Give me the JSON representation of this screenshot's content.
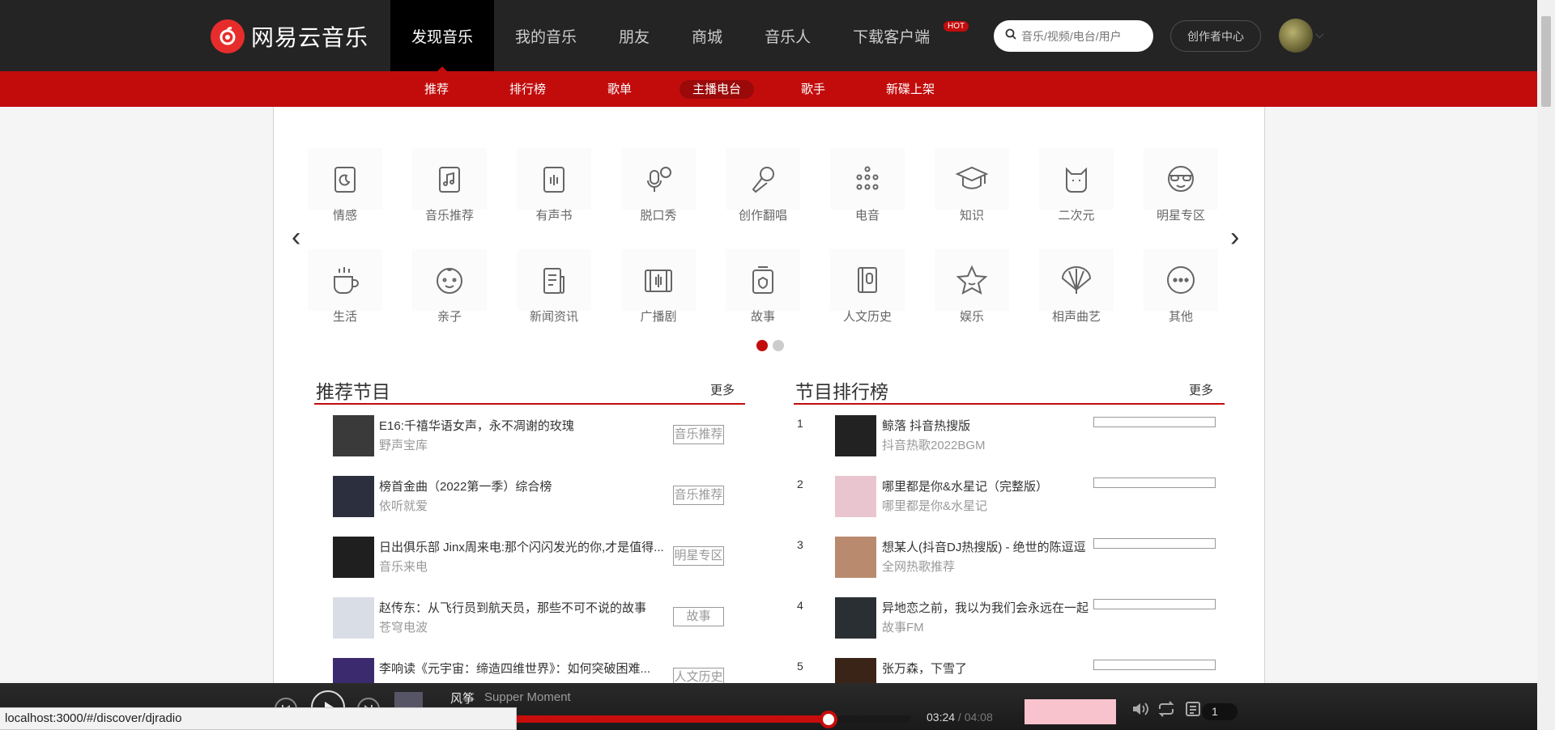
{
  "app": {
    "logo_text": "网易云音乐"
  },
  "nav": {
    "items": [
      {
        "label": "发现音乐",
        "active": true
      },
      {
        "label": "我的音乐"
      },
      {
        "label": "朋友"
      },
      {
        "label": "商城"
      },
      {
        "label": "音乐人"
      },
      {
        "label": "下载客户端"
      }
    ],
    "hot_badge": "HOT"
  },
  "search": {
    "placeholder": "音乐/视频/电台/用户"
  },
  "creator_button": "创作者中心",
  "subnav": {
    "items": [
      "推荐",
      "排行榜",
      "歌单",
      "主播电台",
      "歌手",
      "新碟上架"
    ],
    "active_index": 3
  },
  "categories": {
    "row1": [
      "情感",
      "音乐推荐",
      "有声书",
      "脱口秀",
      "创作翻唱",
      "电音",
      "知识",
      "二次元",
      "明星专区"
    ],
    "row2": [
      "生活",
      "亲子",
      "新闻资讯",
      "广播剧",
      "故事",
      "人文历史",
      "娱乐",
      "相声曲艺",
      "其他"
    ],
    "page_count": 2,
    "current_page": 1
  },
  "recommended": {
    "title": "推荐节目",
    "more": "更多",
    "items": [
      {
        "title": "E16:千禧华语女声，永不凋谢的玫瑰",
        "sub": "野声宝库",
        "tag": "音乐推荐"
      },
      {
        "title": "榜首金曲（2022第一季）综合榜",
        "sub": "依听就爱",
        "tag": "音乐推荐"
      },
      {
        "title": "日出俱乐部 Jinx周来电:那个闪闪发光的你,才是值得...",
        "sub": "音乐来电",
        "tag": "明星专区"
      },
      {
        "title": "赵传东：从飞行员到航天员，那些不可不说的故事",
        "sub": "苍穹电波",
        "tag": "故事"
      },
      {
        "title": "李响读《元宇宙：缔造四维世界》：如何突破困难...",
        "sub": "",
        "tag": "人文历史"
      }
    ]
  },
  "ranking": {
    "title": "节目排行榜",
    "more": "更多",
    "items": [
      {
        "rank": "1",
        "title": "鲸落 抖音热搜版",
        "sub": "抖音热歌2022BGM"
      },
      {
        "rank": "2",
        "title": "哪里都是你&水星记（完整版）",
        "sub": "哪里都是你&水星记"
      },
      {
        "rank": "3",
        "title": "想某人(抖音DJ热搜版) - 绝世的陈逗逗",
        "sub": "全网热歌推荐"
      },
      {
        "rank": "4",
        "title": "异地恋之前，我以为我们会永远在一起",
        "sub": "故事FM"
      },
      {
        "rank": "5",
        "title": "张万森，下雪了",
        "sub": ""
      }
    ]
  },
  "player": {
    "song": "风筝",
    "artist": "Supper Moment",
    "current_time": "03:24",
    "total_time": "04:08",
    "progress": 0.8226,
    "playlist_count": "1"
  },
  "status_bar": {
    "url": "localhost:3000/#/discover/djradio"
  }
}
